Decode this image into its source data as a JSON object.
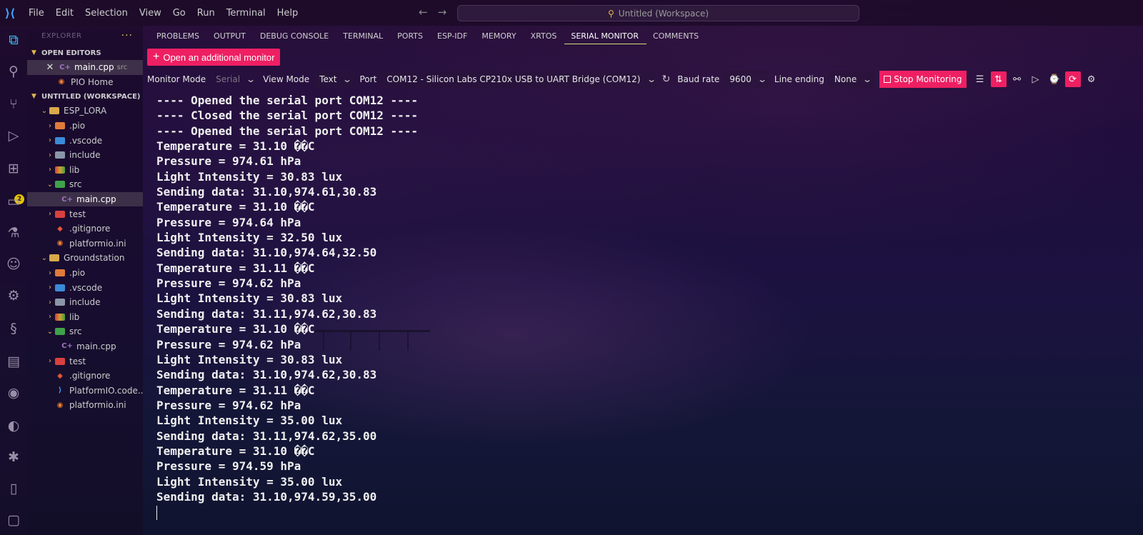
{
  "titlebar": {
    "menu": [
      "File",
      "Edit",
      "Selection",
      "View",
      "Go",
      "Run",
      "Terminal",
      "Help"
    ],
    "search_text": "Untitled (Workspace)"
  },
  "activity_bar": {
    "extensions_badge": "2"
  },
  "sidebar": {
    "title": "EXPLORER",
    "open_editors_label": "OPEN EDITORS",
    "open_editors": [
      {
        "name": "main.cpp",
        "desc": "src"
      },
      {
        "name": "PIO Home"
      }
    ],
    "workspace_label": "UNTITLED (WORKSPACE)",
    "folder1": {
      "name": "ESP_LORA",
      "items": [
        ".pio",
        ".vscode",
        "include",
        "lib",
        "src",
        "main.cpp",
        "test",
        ".gitignore",
        "platformio.ini"
      ]
    },
    "folder2": {
      "name": "Groundstation",
      "items": [
        ".pio",
        ".vscode",
        "include",
        "lib",
        "src",
        "main.cpp",
        "test",
        ".gitignore",
        "PlatformIO.code...",
        "platformio.ini"
      ]
    }
  },
  "panel": {
    "tabs": [
      "PROBLEMS",
      "OUTPUT",
      "DEBUG CONSOLE",
      "TERMINAL",
      "PORTS",
      "ESP-IDF",
      "MEMORY",
      "XRTOS",
      "SERIAL MONITOR",
      "COMMENTS"
    ],
    "active_tab": "SERIAL MONITOR",
    "open_monitor_label": "Open an additional monitor"
  },
  "toolbar": {
    "monitor_mode_label": "Monitor Mode",
    "monitor_mode_value": "Serial",
    "view_mode_label": "View Mode",
    "view_mode_value": "Text",
    "port_label": "Port",
    "port_value": "COM12 - Silicon Labs CP210x USB to UART Bridge (COM12)",
    "baud_label": "Baud rate",
    "baud_value": "9600",
    "line_ending_label": "Line ending",
    "line_ending_value": "None",
    "stop_label": "Stop Monitoring"
  },
  "serial_output": [
    "---- Opened the serial port COM12 ----",
    "---- Closed the serial port COM12 ----",
    "---- Opened the serial port COM12 ----",
    "Temperature = 31.10 ��C",
    "Pressure = 974.61 hPa",
    "Light Intensity = 30.83 lux",
    "Sending data: 31.10,974.61,30.83",
    "Temperature = 31.10 ��C",
    "Pressure = 974.64 hPa",
    "Light Intensity = 32.50 lux",
    "Sending data: 31.10,974.64,32.50",
    "Temperature = 31.11 ��C",
    "Pressure = 974.62 hPa",
    "Light Intensity = 30.83 lux",
    "Sending data: 31.11,974.62,30.83",
    "Temperature = 31.10 ��C",
    "Pressure = 974.62 hPa",
    "Light Intensity = 30.83 lux",
    "Sending data: 31.10,974.62,30.83",
    "Temperature = 31.11 ��C",
    "Pressure = 974.62 hPa",
    "Light Intensity = 35.00 lux",
    "Sending data: 31.11,974.62,35.00",
    "Temperature = 31.10 ��C",
    "Pressure = 974.59 hPa",
    "Light Intensity = 35.00 lux",
    "Sending data: 31.10,974.59,35.00"
  ],
  "colors": {
    "accent_pink": "#ee1f63",
    "active_tab_underline": "#d7e07a",
    "folder_chevron": "#e3b84c"
  }
}
